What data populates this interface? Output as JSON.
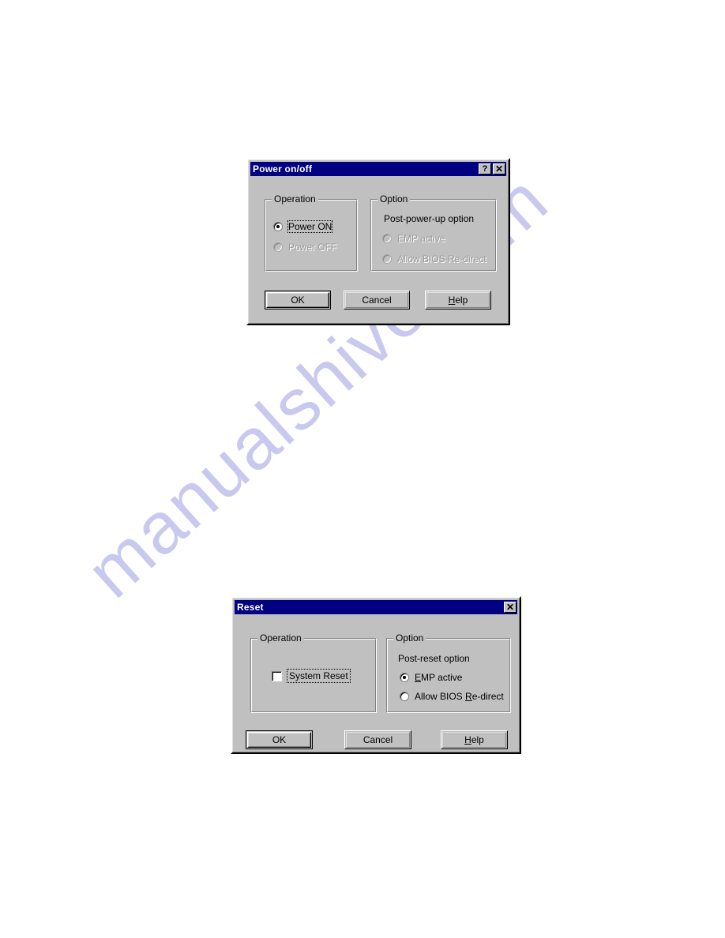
{
  "page": {
    "watermark": "manualshive.com",
    "background_color": "#ffffff",
    "watermark_color": "#c9c9ef"
  },
  "dialogs": [
    {
      "id": "power-on-off",
      "title": "Power on/off",
      "title_bar": {
        "help_button": "?",
        "close_button": "✕",
        "help_icon_name": "help-icon",
        "close_icon_name": "close-icon"
      },
      "operation_group": {
        "legend": "Operation",
        "radios": [
          {
            "label": "Power ON",
            "selected": true,
            "disabled": false,
            "focused": true,
            "accel": "N"
          },
          {
            "label": "Power OFF",
            "selected": false,
            "disabled": true,
            "focused": false,
            "accel": "F"
          }
        ]
      },
      "option_group": {
        "legend": "Option",
        "caption": "Post-power-up option",
        "radios": [
          {
            "label": "EMP active",
            "selected": false,
            "disabled": true,
            "accel": "E"
          },
          {
            "label": "Allow BIOS Re-direct",
            "selected": false,
            "disabled": true,
            "accel": "R"
          }
        ]
      },
      "buttons": [
        {
          "label": "OK",
          "default": true,
          "accel": ""
        },
        {
          "label": "Cancel",
          "default": false,
          "accel": ""
        },
        {
          "label": "Help",
          "default": false,
          "accel": "H"
        }
      ]
    },
    {
      "id": "reset",
      "title": "Reset",
      "title_bar": {
        "close_button": "✕",
        "close_icon_name": "close-icon"
      },
      "operation_group": {
        "legend": "Operation",
        "checkbox": {
          "label": "System Reset",
          "checked": false,
          "focused": true,
          "accel": "S"
        }
      },
      "option_group": {
        "legend": "Option",
        "caption": "Post-reset option",
        "radios": [
          {
            "label": "EMP active",
            "selected": true,
            "disabled": false,
            "accel": "E"
          },
          {
            "label": "Allow BIOS Re-direct",
            "selected": false,
            "disabled": false,
            "accel": "R"
          }
        ]
      },
      "buttons": [
        {
          "label": "OK",
          "default": true,
          "accel": ""
        },
        {
          "label": "Cancel",
          "default": false,
          "accel": ""
        },
        {
          "label": "Help",
          "default": false,
          "accel": "H"
        }
      ]
    }
  ],
  "colors": {
    "titlebar": "#000080",
    "dialog_face": "#c0c0c0",
    "text": "#000000",
    "disabled_text": "#9a9a9a"
  }
}
